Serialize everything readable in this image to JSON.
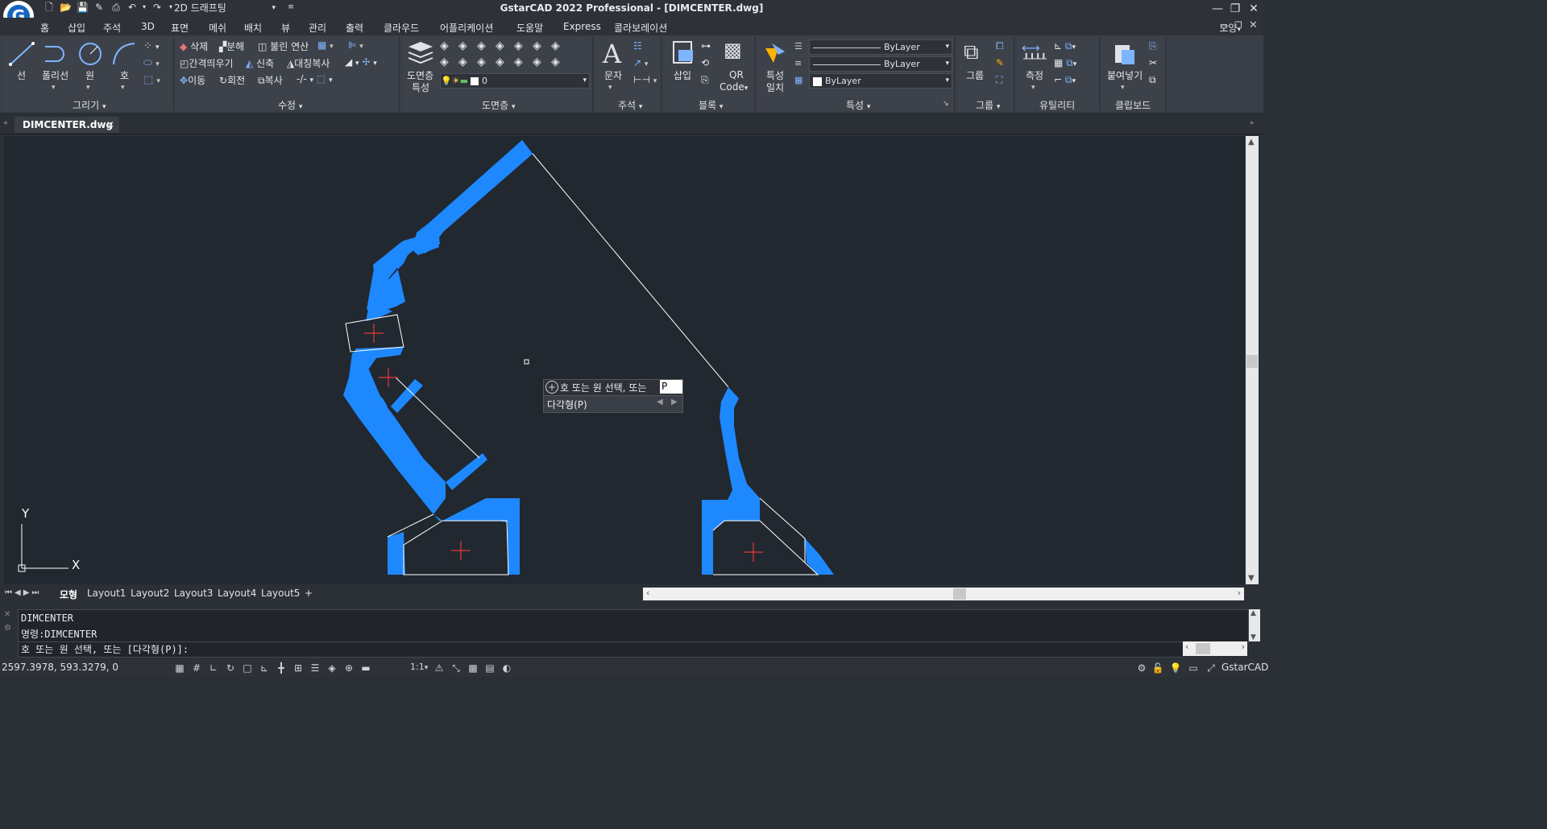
{
  "app": {
    "title": "GstarCAD 2022 Professional - [DIMCENTER.dwg]",
    "logo_letter": "G",
    "workspace": "2D 드래프팅"
  },
  "menubar": {
    "items": [
      "홈",
      "삽입",
      "주석",
      "3D",
      "표면",
      "메쉬",
      "배치",
      "뷰",
      "관리",
      "출력",
      "클라우드",
      "어플리케이션",
      "도움말",
      "Express",
      "콜라보레이션"
    ],
    "right_label": "모양"
  },
  "ribbon": {
    "draw": {
      "title": "그리기",
      "line": "선",
      "polyline": "폴리선",
      "circle": "원",
      "arc": "호"
    },
    "modify": {
      "title": "수정",
      "erase": "삭제",
      "explode": "분해",
      "boolean": "불린 연산",
      "offset": "간격띄우기",
      "stretch": "신축",
      "mirror": "대칭복사",
      "move": "이동",
      "rotate": "회전",
      "copy": "복사"
    },
    "layers": {
      "title": "도면층",
      "properties_line1": "도면층",
      "properties_line2": "특성",
      "current_layer": "0"
    },
    "annotation": {
      "title": "주석",
      "text": "문자"
    },
    "block": {
      "title": "블록",
      "insert": "삽입",
      "qr_line1": "QR",
      "qr_line2": "Code"
    },
    "properties": {
      "title": "특성",
      "match_line1": "특성",
      "match_line2": "일치",
      "linetype": "ByLayer",
      "lineweight": "ByLayer",
      "color": "ByLayer"
    },
    "group": {
      "title": "그룹",
      "group": "그룹"
    },
    "utility": {
      "title": "유틸리티",
      "measure": "측정"
    },
    "clipboard": {
      "title": "클립보드",
      "paste": "붙여넣기"
    }
  },
  "doc_tab": {
    "name": "DIMCENTER.dwg"
  },
  "canvas": {
    "ucs_x": "X",
    "ucs_y": "Y",
    "prompt_text": "호 또는 원 선택, 또는",
    "prompt_value": "P",
    "prompt_option": "다각형(P)"
  },
  "layout_tabs": [
    "모형",
    "Layout1",
    "Layout2",
    "Layout3",
    "Layout4",
    "Layout5",
    "+"
  ],
  "command": {
    "history": [
      "DIMCENTER",
      "명령:DIMCENTER"
    ],
    "current": "호 또는 원 선택, 또는 [다각형(P)]:"
  },
  "status": {
    "coordinates": "2597.3978, 593.3279, 0",
    "scale": "1:1",
    "brand": "GstarCAD"
  },
  "colors": {
    "shape_fill": "#1e88ff",
    "center_mark": "#e53935",
    "canvas_bg": "#212830"
  }
}
